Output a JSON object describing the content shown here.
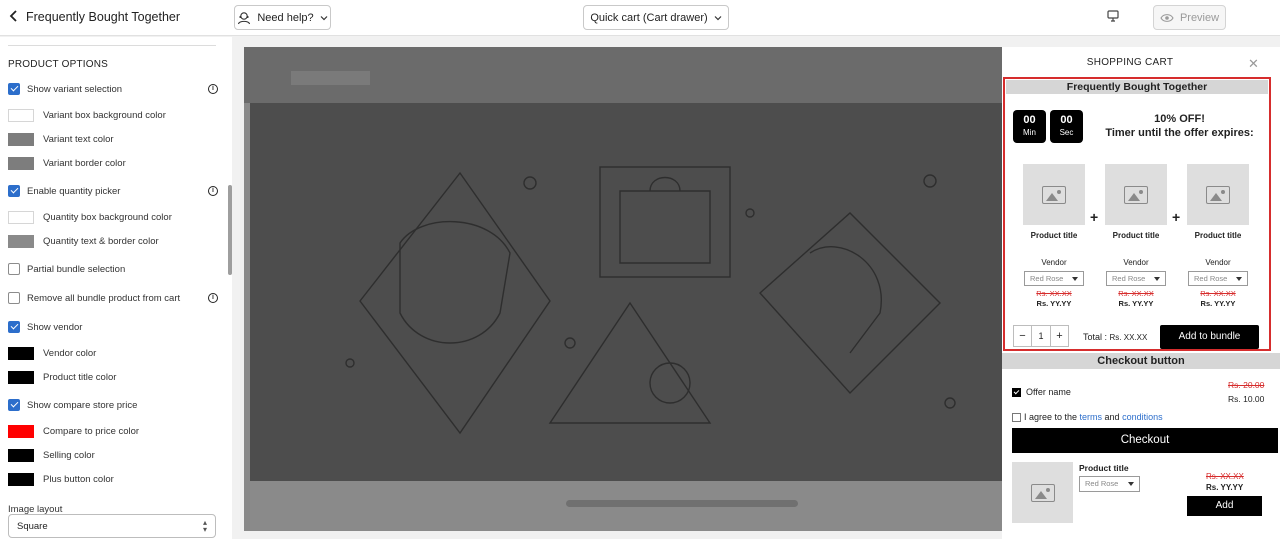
{
  "topbar": {
    "title": "Frequently Bought Together",
    "need_help": "Need help?",
    "quick_cart": "Quick cart (Cart drawer)",
    "preview": "Preview"
  },
  "panel": {
    "section_title": "PRODUCT OPTIONS",
    "rows": [
      {
        "kind": "checkbox",
        "checked": true,
        "label": "Show variant selection",
        "info": true
      },
      {
        "kind": "color",
        "color": "#ffffff",
        "label": "Variant box background color"
      },
      {
        "kind": "color",
        "color": "#7d7d7d",
        "label": "Variant text color"
      },
      {
        "kind": "color",
        "color": "#7d7d7d",
        "label": "Variant border color"
      },
      {
        "kind": "checkbox",
        "checked": true,
        "label": "Enable quantity picker",
        "info": true
      },
      {
        "kind": "color",
        "color": "#ffffff",
        "label": "Quantity box background color"
      },
      {
        "kind": "color",
        "color": "#8a8a8a",
        "label": "Quantity text & border color"
      },
      {
        "kind": "checkbox",
        "checked": false,
        "label": "Partial bundle selection",
        "info": false
      },
      {
        "kind": "checkbox",
        "checked": false,
        "label": "Remove all bundle product from cart",
        "info": true
      },
      {
        "kind": "checkbox",
        "checked": true,
        "label": "Show vendor",
        "info": false
      },
      {
        "kind": "color",
        "color": "#000000",
        "label": "Vendor color"
      },
      {
        "kind": "color",
        "color": "#000000",
        "label": "Product title color"
      },
      {
        "kind": "checkbox",
        "checked": true,
        "label": "Show compare store price",
        "info": false
      },
      {
        "kind": "color",
        "color": "#ff0000",
        "label": "Compare to price color"
      },
      {
        "kind": "color",
        "color": "#000000",
        "label": "Selling color"
      },
      {
        "kind": "color",
        "color": "#000000",
        "label": "Plus button color"
      }
    ],
    "image_layout_label": "Image layout",
    "image_layout_value": "Square"
  },
  "drawer": {
    "title": "SHOPPING CART",
    "fbt": {
      "title": "Frequently Bought Together",
      "timer_min": "00",
      "timer_min_label": "Min",
      "timer_sec": "00",
      "timer_sec_label": "Sec",
      "offer": "10% OFF!",
      "timer_text": "Timer until the offer expires:",
      "products": [
        {
          "title": "Product title",
          "vendor": "Vendor",
          "variant": "Red Rose",
          "compare": "Rs. XX.XX",
          "price": "Rs. YY.YY"
        },
        {
          "title": "Product title",
          "vendor": "Vendor",
          "variant": "Red Rose",
          "compare": "Rs. XX.XX",
          "price": "Rs. YY.YY"
        },
        {
          "title": "Product title",
          "vendor": "Vendor",
          "variant": "Red Rose",
          "compare": "Rs. XX.XX",
          "price": "Rs. YY.YY"
        }
      ],
      "qty_minus": "−",
      "qty_value": "1",
      "qty_plus": "+",
      "total_label": "Total :",
      "total_value": "Rs. XX.XX",
      "add_button": "Add to bundle"
    },
    "checkout": {
      "title": "Checkout button",
      "offer_name": "Offer name",
      "offer_compare": "Rs. 20.00",
      "offer_price": "Rs. 10.00",
      "agree_prefix": "I agree to the ",
      "agree_terms": "terms",
      "agree_and": " and ",
      "agree_conditions": "conditions",
      "checkout_button": "Checkout"
    },
    "upsell": {
      "title": "Product title",
      "variant": "Red Rose",
      "compare": "Rs. XX.XX",
      "price": "Rs. YY.YY",
      "add_button": "Add"
    }
  },
  "colors": {
    "accent": "#2c6ecb",
    "highlight_border": "#d62d2d"
  }
}
